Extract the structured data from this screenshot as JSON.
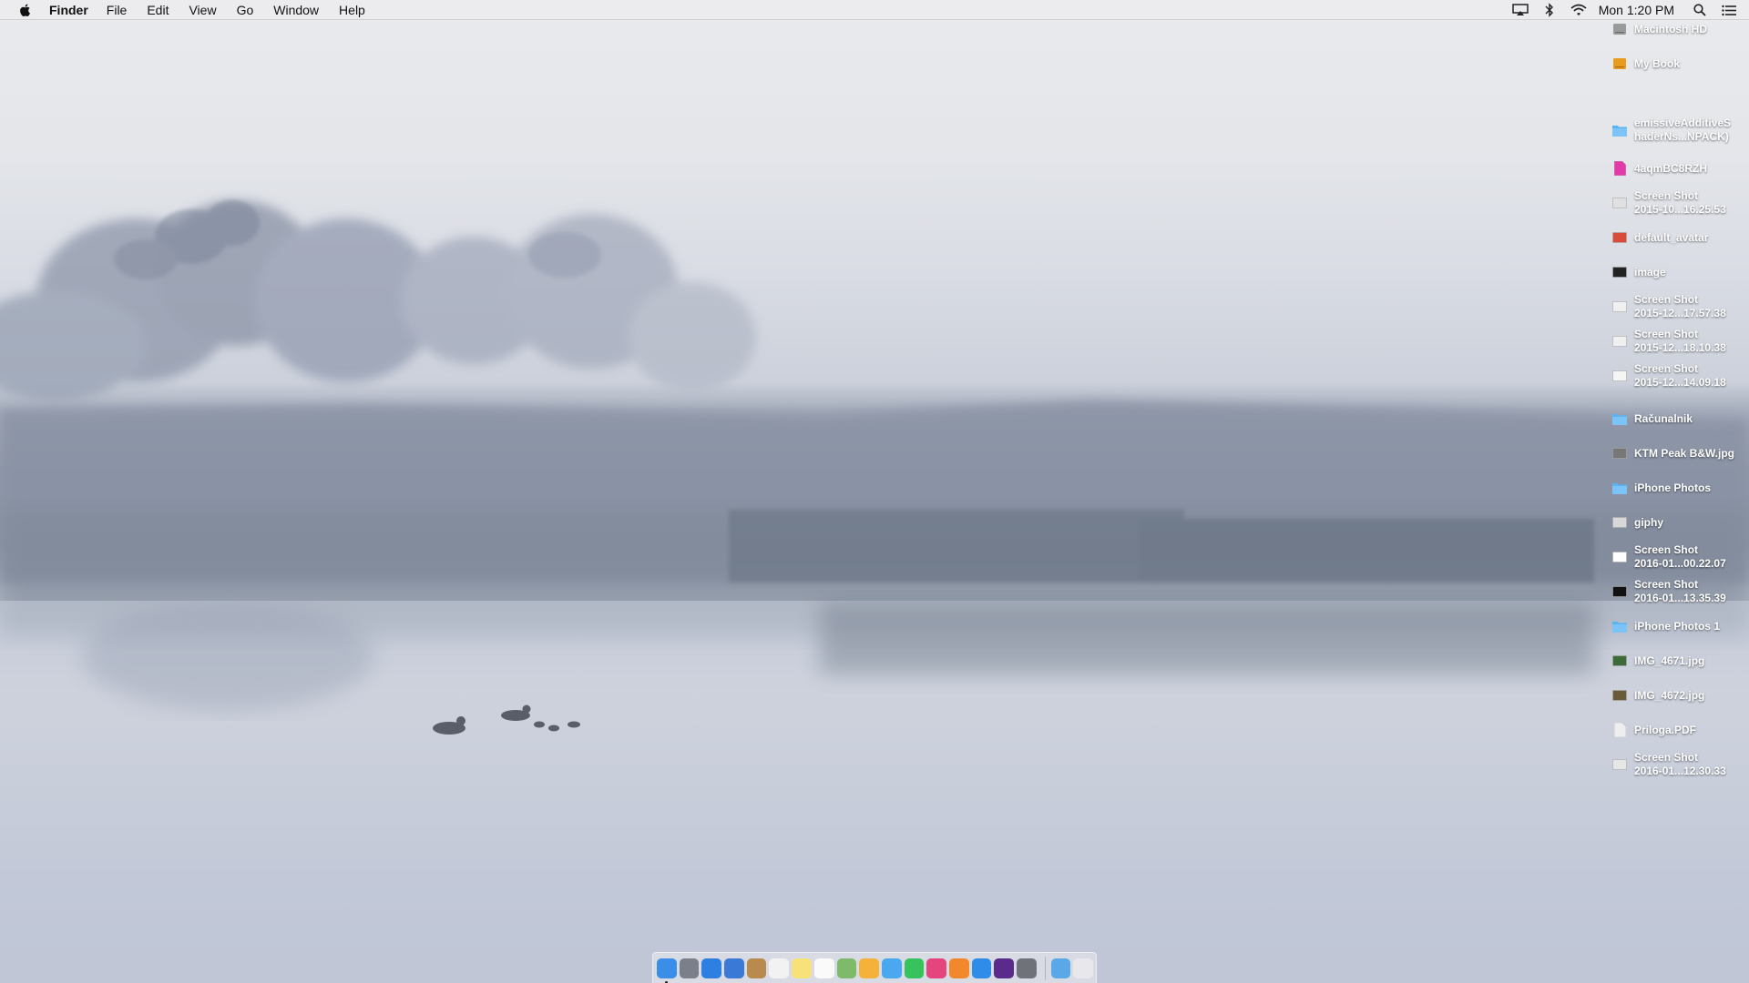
{
  "menubar": {
    "app_name": "Finder",
    "menus": [
      "File",
      "Edit",
      "View",
      "Go",
      "Window",
      "Help"
    ],
    "clock": "Mon 1:20 PM",
    "status_icons": [
      "airplay-icon",
      "bluetooth-icon",
      "wifi-icon",
      "spotlight-search-icon",
      "notification-center-icon"
    ]
  },
  "desktop": {
    "icons": [
      {
        "label": "Macintosh HD",
        "icon": "hard-drive-icon",
        "color": "#9a9a9a"
      },
      {
        "label": "My Book",
        "icon": "external-drive-icon",
        "color": "#e89b1c"
      },
      {
        "label": "emissiveAdditiveS\nhaderNs...NPACK)",
        "icon": "folder-icon",
        "color": "#5cb3f2"
      },
      {
        "label": "4aqmBC8RZH",
        "icon": "pink-document-icon",
        "color": "#e23aa8"
      },
      {
        "label": "Screen Shot\n2015-10...16.25.53",
        "icon": "screenshot-thumbnail-icon",
        "color": "#e0e0e0"
      },
      {
        "label": "default_avatar",
        "icon": "avatar-image-icon",
        "color": "#d84a3a"
      },
      {
        "label": "image",
        "icon": "dark-image-icon",
        "color": "#222222"
      },
      {
        "label": "Screen Shot\n2015-12...17.57.38",
        "icon": "screenshot-thumbnail-icon",
        "color": "#f0f0f0"
      },
      {
        "label": "Screen Shot\n2015-12...18.10.38",
        "icon": "screenshot-thumbnail-icon",
        "color": "#f0f0f0"
      },
      {
        "label": "Screen Shot\n2015-12...14.09.18",
        "icon": "screenshot-thumbnail-icon",
        "color": "#f5f5f5"
      },
      {
        "label": "Računalnik",
        "icon": "folder-icon",
        "color": "#5cb3f2"
      },
      {
        "label": "KTM Peak B&W.jpg",
        "icon": "photo-thumbnail-icon",
        "color": "#777777"
      },
      {
        "label": "iPhone Photos",
        "icon": "folder-icon",
        "color": "#5cb3f2"
      },
      {
        "label": "giphy",
        "icon": "gif-thumbnail-icon",
        "color": "#d8d8d8"
      },
      {
        "label": "Screen Shot\n2016-01...00.22.07",
        "icon": "screenshot-thumbnail-icon",
        "color": "#ffffff"
      },
      {
        "label": "Screen Shot\n2016-01...13.35.39",
        "icon": "screenshot-thumbnail-icon",
        "color": "#111111"
      },
      {
        "label": "iPhone Photos 1",
        "icon": "folder-icon",
        "color": "#5cb3f2"
      },
      {
        "label": "IMG_4671.jpg",
        "icon": "photo-thumbnail-icon",
        "color": "#3e6a3a"
      },
      {
        "label": "IMG_4672.jpg",
        "icon": "photo-thumbnail-icon",
        "color": "#6a5a3a"
      },
      {
        "label": "Priloga.PDF",
        "icon": "pdf-document-icon",
        "color": "#eeeeee"
      },
      {
        "label": "Screen Shot\n2016-01...12.30.33",
        "icon": "screenshot-thumbnail-icon",
        "color": "#e6e6e6"
      }
    ]
  },
  "dock": {
    "apps": [
      {
        "name": "finder-icon",
        "color": "#3a8ee8"
      },
      {
        "name": "launchpad-icon",
        "color": "#7a7f89"
      },
      {
        "name": "safari-icon",
        "color": "#2d7fe0"
      },
      {
        "name": "mail-icon",
        "color": "#3b79d6"
      },
      {
        "name": "contacts-icon",
        "color": "#b88a4e"
      },
      {
        "name": "calendar-icon",
        "color": "#f2f2f2"
      },
      {
        "name": "notes-icon",
        "color": "#f7e27a"
      },
      {
        "name": "reminders-icon",
        "color": "#fafafa"
      },
      {
        "name": "maps-icon",
        "color": "#7dbb6a"
      },
      {
        "name": "photos-icon",
        "color": "#f4b23a"
      },
      {
        "name": "messages-icon",
        "color": "#4aa8f0"
      },
      {
        "name": "facetime-icon",
        "color": "#36c25c"
      },
      {
        "name": "itunes-icon",
        "color": "#e4457c"
      },
      {
        "name": "ibooks-icon",
        "color": "#f2872c"
      },
      {
        "name": "app-store-icon",
        "color": "#2f8ce8"
      },
      {
        "name": "affinity-designer-icon",
        "color": "#5a2a8c"
      },
      {
        "name": "system-preferences-icon",
        "color": "#6f7278"
      }
    ],
    "extras": [
      {
        "name": "downloads-stack-icon",
        "color": "#5aa8e8"
      },
      {
        "name": "trash-icon",
        "color": "#e8e8ec"
      }
    ]
  }
}
